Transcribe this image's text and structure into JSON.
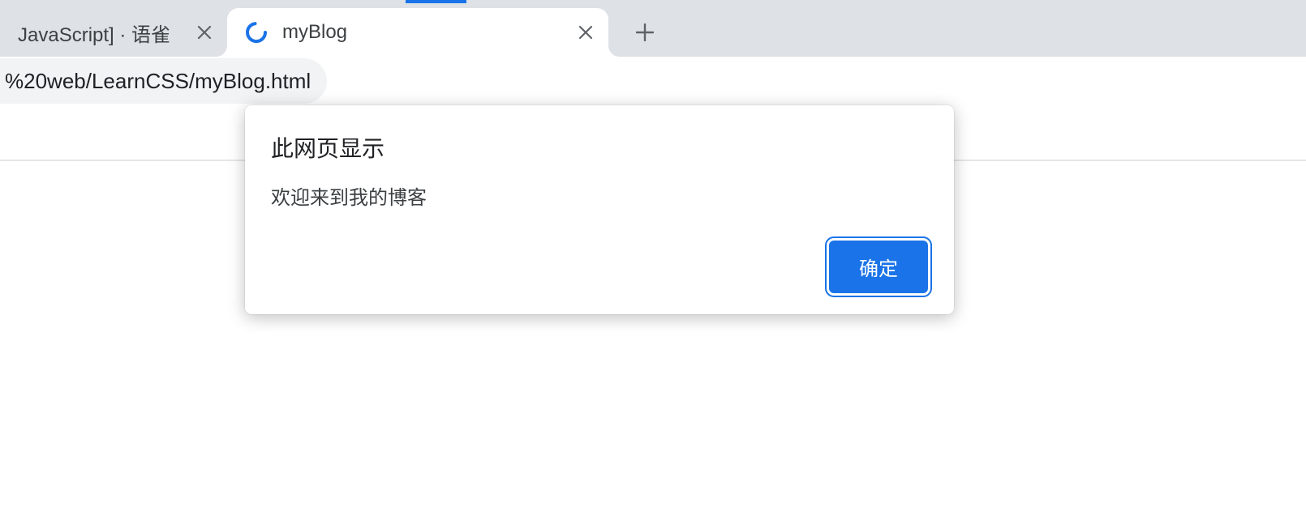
{
  "tabs": {
    "inactive": {
      "title": "JavaScript] · 语雀"
    },
    "active": {
      "title": "myBlog"
    }
  },
  "address": {
    "url": "%20web/LearnCSS/myBlog.html"
  },
  "dialog": {
    "title": "此网页显示",
    "message": "欢迎来到我的博客",
    "ok_label": "确定"
  }
}
